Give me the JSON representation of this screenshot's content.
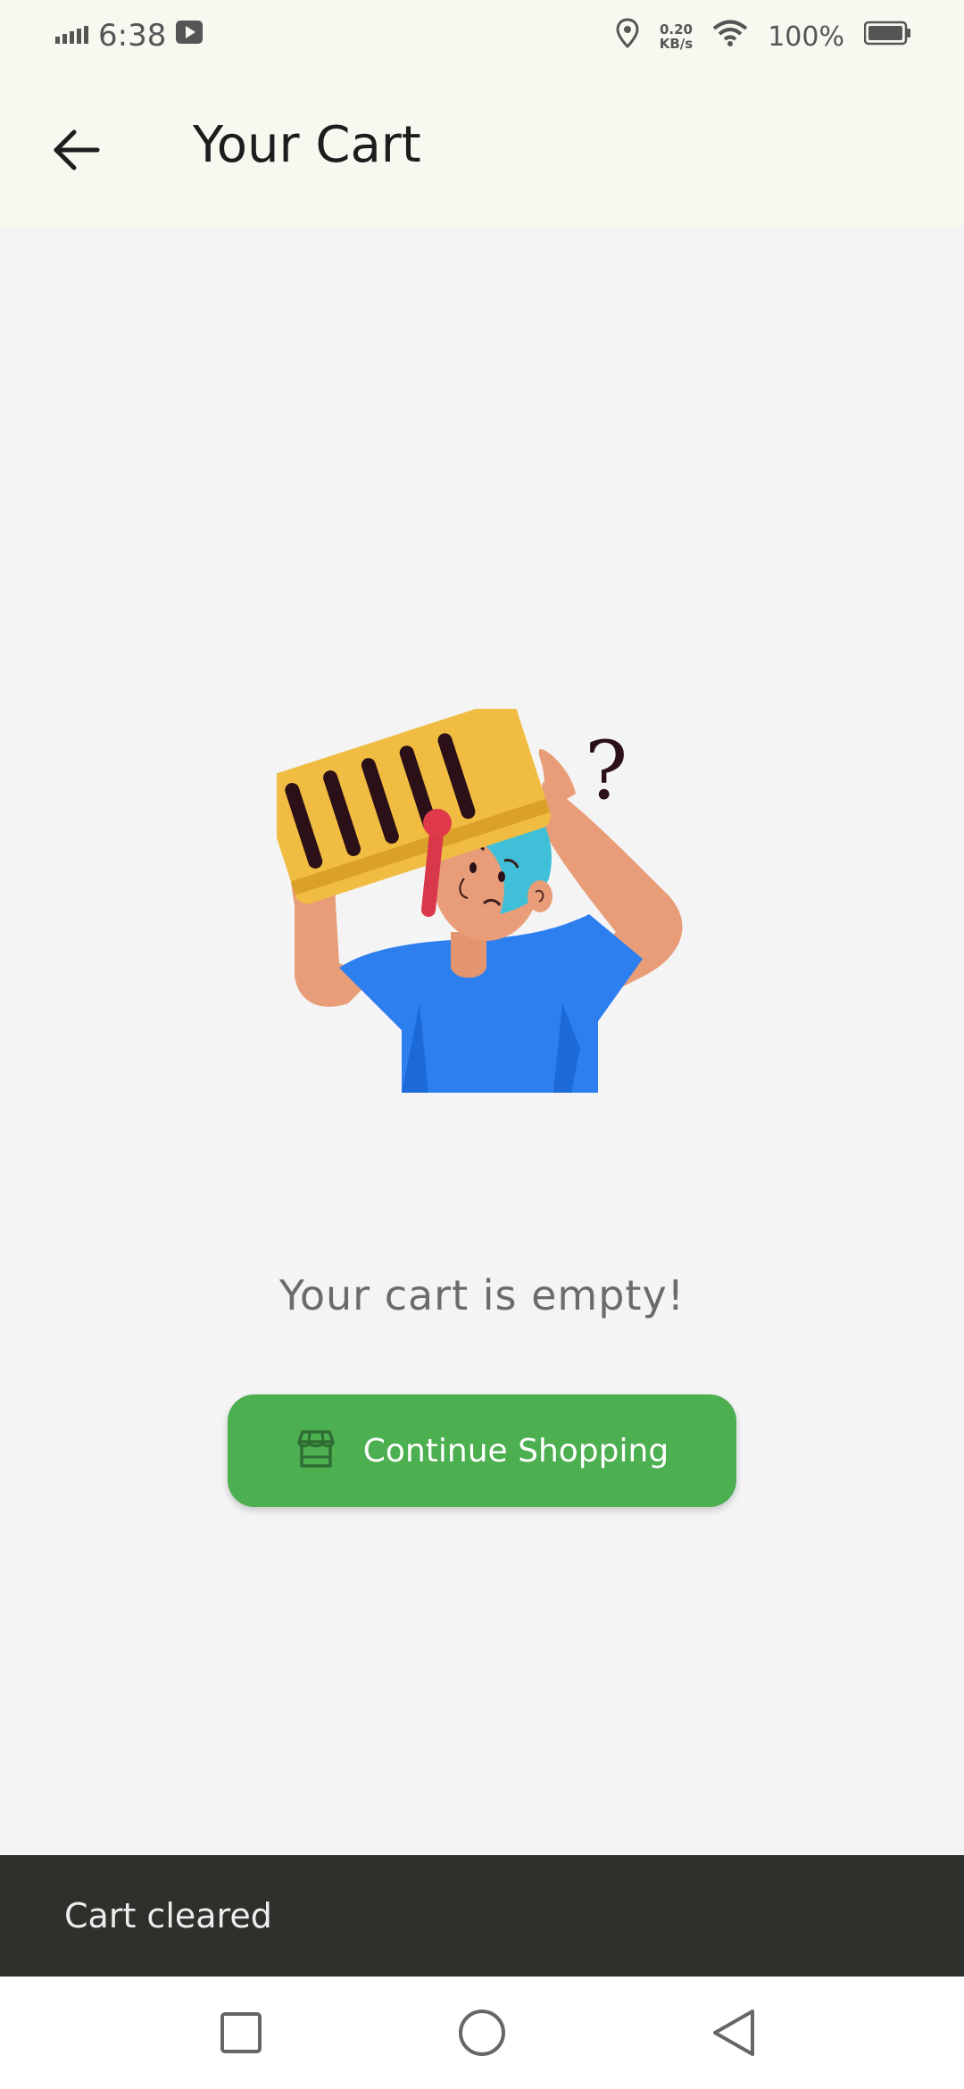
{
  "status_bar": {
    "time": "6:38",
    "net_speed_value": "0.20",
    "net_speed_unit": "KB/s",
    "battery": "100%",
    "icons": [
      "signal-icon",
      "youtube-icon",
      "location-icon",
      "wifi-icon",
      "battery-icon"
    ]
  },
  "app_bar": {
    "title": "Your Cart",
    "back_icon": "arrow-left-icon"
  },
  "main": {
    "empty_message": "Your cart is empty!",
    "illustration": "empty-cart-illustration",
    "question_mark": "?",
    "button": {
      "label": "Continue Shopping",
      "icon": "storefront-icon"
    }
  },
  "snackbar": {
    "message": "Cart cleared"
  },
  "nav_bar": {
    "icons": [
      "recents-square-icon",
      "home-circle-icon",
      "back-triangle-icon"
    ]
  },
  "colors": {
    "app_bar_bg": "#f7f9f1",
    "content_bg": "#f4f4f5",
    "button_green": "#4caf50",
    "snackbar_bg": "#2e302c"
  }
}
